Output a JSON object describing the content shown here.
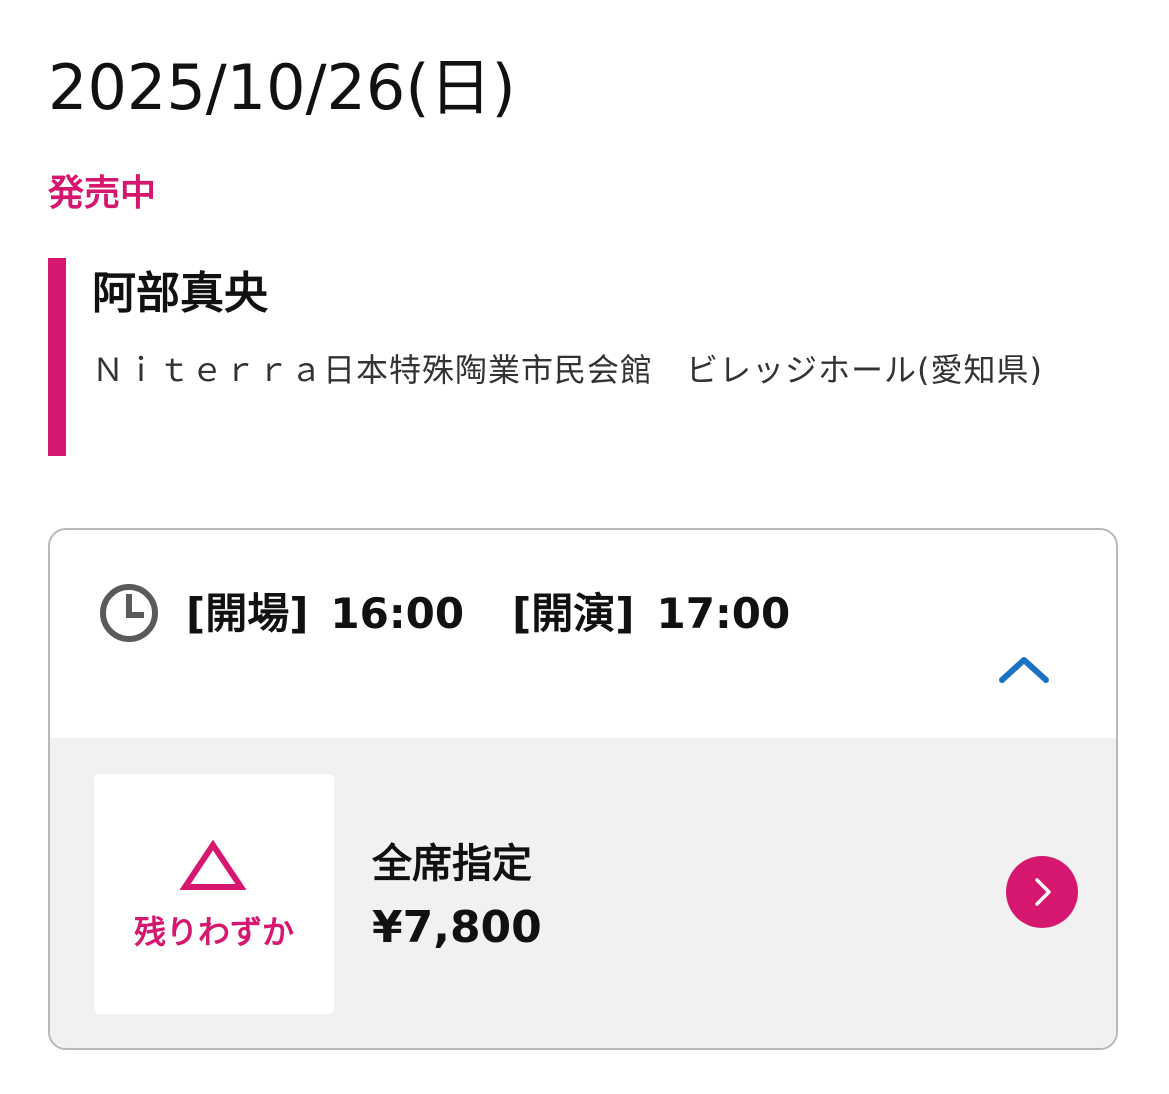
{
  "date": "2025/10/26(日)",
  "sale_status": "発売中",
  "performer": "阿部真央",
  "venue": "Ｎｉｔｅｒｒａ日本特殊陶業市民会館　ビレッジホール(愛知県)",
  "times": {
    "open_label": "[開場]",
    "open_time": "16:00",
    "start_label": "[開演]",
    "start_time": "17:00"
  },
  "ticket": {
    "availability": "残りわずか",
    "seat_type": "全席指定",
    "price": "¥7,800"
  },
  "icons": {
    "clock": "clock-icon",
    "collapse": "chevron-up-icon",
    "availability": "triangle-icon",
    "go": "chevron-right-icon"
  },
  "colors": {
    "accent": "#d6176f",
    "link_blue": "#1a73c2",
    "clock_gray": "#5a5a5a",
    "text": "#111111",
    "body_bg": "#f1f1f1",
    "border": "#b8b8b8"
  }
}
